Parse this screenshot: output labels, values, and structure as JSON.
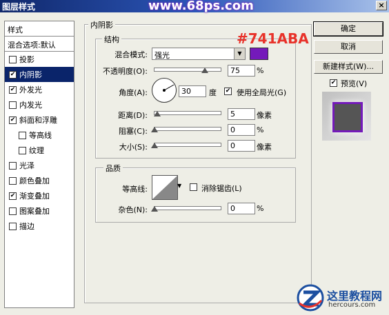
{
  "window": {
    "title": "图层样式",
    "watermark": "www.68ps.com",
    "close_label": "×"
  },
  "styles_panel": {
    "header": "样式",
    "blend_options": "混合选项:默认",
    "items": [
      {
        "label": "投影",
        "checked": false,
        "sub": false,
        "selected": false
      },
      {
        "label": "内阴影",
        "checked": true,
        "sub": false,
        "selected": true
      },
      {
        "label": "外发光",
        "checked": true,
        "sub": false,
        "selected": false
      },
      {
        "label": "内发光",
        "checked": false,
        "sub": false,
        "selected": false
      },
      {
        "label": "斜面和浮雕",
        "checked": true,
        "sub": false,
        "selected": false
      },
      {
        "label": "等高线",
        "checked": false,
        "sub": true,
        "selected": false
      },
      {
        "label": "纹理",
        "checked": false,
        "sub": true,
        "selected": false
      },
      {
        "label": "光泽",
        "checked": false,
        "sub": false,
        "selected": false
      },
      {
        "label": "颜色叠加",
        "checked": false,
        "sub": false,
        "selected": false
      },
      {
        "label": "渐变叠加",
        "checked": true,
        "sub": false,
        "selected": false
      },
      {
        "label": "图案叠加",
        "checked": false,
        "sub": false,
        "selected": false
      },
      {
        "label": "描边",
        "checked": false,
        "sub": false,
        "selected": false
      }
    ]
  },
  "inner_shadow": {
    "section_title": "内阴影",
    "structure_title": "结构",
    "color_annotation": "#741ABA",
    "blend_mode_label": "混合模式:",
    "blend_mode_value": "强光",
    "color": "#741aba",
    "opacity_label": "不透明度(O):",
    "opacity_value": "75",
    "opacity_unit": "%",
    "angle_label": "角度(A):",
    "angle_value": "30",
    "angle_unit": "度",
    "global_light_label": "使用全局光(G)",
    "global_light_checked": true,
    "distance_label": "距离(D):",
    "distance_value": "5",
    "distance_unit": "像素",
    "choke_label": "阻塞(C):",
    "choke_value": "0",
    "choke_unit": "%",
    "size_label": "大小(S):",
    "size_value": "0",
    "size_unit": "像素"
  },
  "quality": {
    "title": "品质",
    "contour_label": "等高线:",
    "anti_alias_label": "消除锯齿(L)",
    "anti_alias_checked": false,
    "noise_label": "杂色(N):",
    "noise_value": "0",
    "noise_unit": "%"
  },
  "buttons": {
    "ok": "确定",
    "cancel": "取消",
    "new_style": "新建样式(W)...",
    "preview_label": "预览(V)",
    "preview_checked": true
  },
  "logo": {
    "text": "这里教程网",
    "url_text": "hercours.com"
  }
}
